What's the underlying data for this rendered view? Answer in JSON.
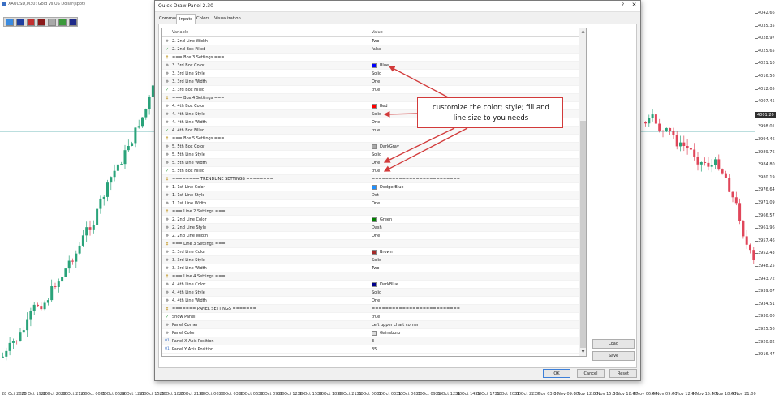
{
  "chart": {
    "title": "XAUUSD,M30:  Gold vs US Dollar(spot)",
    "prices": [
      "4042.66",
      "4035.35",
      "4028.97",
      "4025.65",
      "4021.10",
      "4016.56",
      "4012.05",
      "4007.45",
      "4001.20",
      "3998.01",
      "3994.46",
      "3989.76",
      "3984.80",
      "3980.19",
      "3976.64",
      "3971.09",
      "3966.57",
      "3961.96",
      "3957.46",
      "3952.43",
      "3948.25",
      "3943.72",
      "3939.07",
      "3934.51",
      "3930.00",
      "3925.56",
      "3920.82",
      "3916.47"
    ],
    "highlight_price": "4001.20",
    "times": [
      "28 Oct 2025",
      "28 Oct 19:00",
      "28 Oct 20:00",
      "28 Oct 21:00",
      "29 Oct 00:00",
      "29 Oct 06:00",
      "29 Oct 12:00",
      "29 Oct 15:00",
      "29 Oct 18:00",
      "29 Oct 21:00",
      "30 Oct 00:00",
      "30 Oct 03:00",
      "30 Oct 06:00",
      "30 Oct 09:00",
      "30 Oct 12:00",
      "30 Oct 15:00",
      "30 Oct 18:00",
      "30 Oct 21:00",
      "31 Oct 00:00",
      "31 Oct 03:00",
      "31 Oct 06:00",
      "31 Oct 09:00",
      "31 Oct 12:00",
      "31 Oct 14:00",
      "31 Oct 17:00",
      "31 Oct 20:00",
      "31 Oct 22:00",
      "3 Nov 03:00",
      "3 Nov 09:00",
      "3 Nov 12:00",
      "3 Nov 15:00",
      "3 Nov 18:00",
      "4 Nov 06:00",
      "4 Nov 09:00",
      "4 Nov 12:00",
      "4 Nov 15:00",
      "4 Nov 18:00",
      "4 Nov 21:00"
    ],
    "bull_color": "#2aa37a",
    "bear_color": "#e0465a",
    "grid_line_color": "#4aa6a6"
  },
  "quick_panel": {
    "colors": [
      "#3a8be0",
      "#1f3fa0",
      "#c23030",
      "#8a1a1a",
      "#a8a8a8",
      "#3c9a3c",
      "#1f2a8a"
    ]
  },
  "dialog": {
    "title": "Quick Draw Panel 2.30",
    "help_label": "?",
    "close_label": "✕",
    "tabs": [
      "Common",
      "Inputs",
      "Colors",
      "Visualization"
    ],
    "header": {
      "variable": "Variable",
      "value": "Value"
    },
    "rows": [
      {
        "icon": "pattern",
        "name": "2. 2nd Line Width",
        "value": "Two"
      },
      {
        "icon": "bool",
        "name": "2. 2nd Box Filled",
        "value": "false"
      },
      {
        "icon": "sep",
        "name": "=== Box 3 Settings ===",
        "value": ""
      },
      {
        "icon": "pattern",
        "name": "3. 3rd Box Color",
        "value": "Blue",
        "color": "#0000ff"
      },
      {
        "icon": "pattern",
        "name": "3. 3rd Line Style",
        "value": "Solid"
      },
      {
        "icon": "pattern",
        "name": "3. 3rd Line Width",
        "value": "One"
      },
      {
        "icon": "bool",
        "name": "3. 3rd Box Filled",
        "value": "true"
      },
      {
        "icon": "sep",
        "name": "=== Box 4 Settings ===",
        "value": ""
      },
      {
        "icon": "pattern",
        "name": "4. 4th Box Color",
        "value": "Red",
        "color": "#ff0000"
      },
      {
        "icon": "pattern",
        "name": "4. 4th Line Style",
        "value": "Solid"
      },
      {
        "icon": "pattern",
        "name": "4. 4th Line Width",
        "value": "One"
      },
      {
        "icon": "bool",
        "name": "4. 4th Box Filled",
        "value": "true"
      },
      {
        "icon": "sep",
        "name": "=== Box 5 Settings ===",
        "value": ""
      },
      {
        "icon": "pattern",
        "name": "5. 5th Box Color",
        "value": "DarkGray",
        "color": "#a9a9a9"
      },
      {
        "icon": "pattern",
        "name": "5. 5th Line Style",
        "value": "Solid"
      },
      {
        "icon": "pattern",
        "name": "5. 5th Line Width",
        "value": "One"
      },
      {
        "icon": "bool",
        "name": "5. 5th Box Filled",
        "value": "true"
      },
      {
        "icon": "sep",
        "name": "======== TRENDLINE SETTINGS ========",
        "value": "=========================="
      },
      {
        "icon": "pattern",
        "name": "1. 1st Line Color",
        "value": "DodgerBlue",
        "color": "#1e90ff"
      },
      {
        "icon": "pattern",
        "name": "1. 1st Line Style",
        "value": "Dot"
      },
      {
        "icon": "pattern",
        "name": "1. 1st Line Width",
        "value": "One"
      },
      {
        "icon": "sep",
        "name": "=== Line 2 Settings ===",
        "value": ""
      },
      {
        "icon": "pattern",
        "name": "2. 2nd Line Color",
        "value": "Green",
        "color": "#008000"
      },
      {
        "icon": "pattern",
        "name": "2. 2nd Line Style",
        "value": "Dash"
      },
      {
        "icon": "pattern",
        "name": "2. 2nd Line Width",
        "value": "One"
      },
      {
        "icon": "sep",
        "name": "=== Line 3 Settings ===",
        "value": ""
      },
      {
        "icon": "pattern",
        "name": "3. 3rd Line Color",
        "value": "Brown",
        "color": "#a52a2a"
      },
      {
        "icon": "pattern",
        "name": "3. 3rd Line Style",
        "value": "Solid"
      },
      {
        "icon": "pattern",
        "name": "3. 3rd Line Width",
        "value": "Two"
      },
      {
        "icon": "sep",
        "name": "=== Line 4 Settings ===",
        "value": ""
      },
      {
        "icon": "pattern",
        "name": "4. 4th Line Color",
        "value": "DarkBlue",
        "color": "#00008b"
      },
      {
        "icon": "pattern",
        "name": "4. 4th Line Style",
        "value": "Solid"
      },
      {
        "icon": "pattern",
        "name": "4. 4th Line Width",
        "value": "One"
      },
      {
        "icon": "sep",
        "name": "======= PANEL SETTINGS =======",
        "value": "=========================="
      },
      {
        "icon": "bool",
        "name": "Show Panel",
        "value": "true"
      },
      {
        "icon": "pattern",
        "name": "Panel Corner",
        "value": "Left upper chart corner"
      },
      {
        "icon": "pattern",
        "name": "Panel Color",
        "value": "Gainsboro",
        "color": "#dcdcdc"
      },
      {
        "icon": "num",
        "name": "Panel X Axis Position",
        "value": "3"
      },
      {
        "icon": "num",
        "name": "Panel Y Axis Position",
        "value": "35"
      }
    ],
    "load_label": "Load",
    "save_label": "Save",
    "ok_label": "OK",
    "cancel_label": "Cancel",
    "reset_label": "Reset"
  },
  "callout": {
    "line1": "customize the color; style; fill and",
    "line2": "line size to you needs",
    "color": "#d23a3a"
  }
}
